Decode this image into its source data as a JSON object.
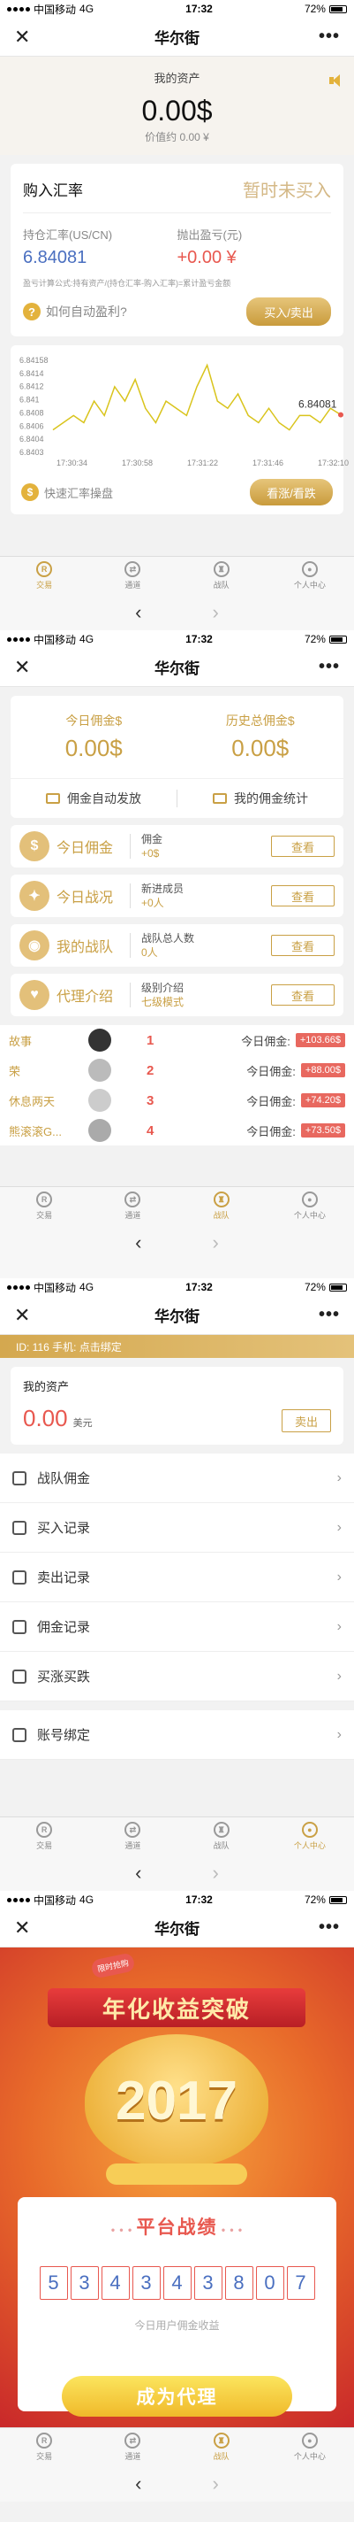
{
  "status_bar": {
    "carrier": "中国移动",
    "network": "4G",
    "time": "17:32",
    "battery": "72%"
  },
  "header": {
    "title": "华尔街",
    "close_glyph": "✕",
    "more_glyph": "•••"
  },
  "tabbar": {
    "items": [
      {
        "label": "交易",
        "glyph": "R",
        "icon": "trade-icon"
      },
      {
        "label": "通道",
        "glyph": "⇄",
        "icon": "channel-icon"
      },
      {
        "label": "战队",
        "glyph": "♜",
        "icon": "trophy-icon"
      },
      {
        "label": "个人中心",
        "glyph": "●",
        "icon": "user-icon"
      }
    ]
  },
  "navbar": {
    "back": "‹",
    "forward": "›"
  },
  "colors": {
    "gold": "#c9a045",
    "red": "#e8584f",
    "blue": "#4a6fc0"
  },
  "screen1": {
    "assets_label": "我的资产",
    "assets_value": "0.00$",
    "assets_sub": "价值约 0.00 ¥",
    "buy_title": "购入汇率",
    "buy_status": "暂时未买入",
    "hold_rate_label": "持仓汇率(US/CN)",
    "hold_rate_value": "6.84081",
    "sell_pl_label": "抛出盈亏(元)",
    "sell_pl_value": "+0.00 ¥",
    "formula": "盈亏计算公式:持有资产/(持仓汇率-购入汇率)=累计盈亏金额",
    "how_profit": "如何自动盈利?",
    "buy_sell_button": "买入/卖出",
    "chart_footer_label": "快速汇率操盘",
    "view_button": "看涨/看跌"
  },
  "chart_data": {
    "type": "line",
    "title": "",
    "xlabel": "",
    "ylabel": "",
    "y_ticks": [
      "6.84158",
      "6.8414",
      "6.8412",
      "6.841",
      "6.8408",
      "6.8406",
      "6.8404",
      "6.8403"
    ],
    "x_ticks": [
      "17:30:34",
      "17:30:58",
      "17:31:22",
      "17:31:46",
      "17:32:10"
    ],
    "ylim": [
      6.8403,
      6.84158
    ],
    "last_value_label": "6.84081",
    "series": [
      {
        "color": "#d9c41c",
        "values": [
          6.8406,
          6.8407,
          6.8408,
          6.8407,
          6.841,
          6.8408,
          6.8412,
          6.841,
          6.8413,
          6.8409,
          6.8407,
          6.841,
          6.8409,
          6.8408,
          6.8412,
          6.8415,
          6.841,
          6.8409,
          6.8411,
          6.8408,
          6.8407,
          6.8409,
          6.8407,
          6.8406,
          6.8408,
          6.8408,
          6.8407,
          6.8409,
          6.84081
        ]
      }
    ],
    "grid": false
  },
  "screen2": {
    "today_label": "今日佣金$",
    "today_value": "0.00$",
    "history_label": "历史总佣金$",
    "history_value": "0.00$",
    "auto_pay": "佣金自动发放",
    "my_stats": "我的佣金统计",
    "rows": [
      {
        "icon": "coin-icon",
        "glyph": "$",
        "name": "今日佣金",
        "a": "佣金",
        "b": "+0$",
        "btn": "查看"
      },
      {
        "icon": "runner-icon",
        "glyph": "✦",
        "name": "今日战况",
        "a": "新进成员",
        "b": "+0人",
        "btn": "查看"
      },
      {
        "icon": "team-icon",
        "glyph": "◉",
        "name": "我的战队",
        "a": "战队总人数",
        "b": "0人",
        "btn": "查看"
      },
      {
        "icon": "agent-icon",
        "glyph": "♥",
        "name": "代理介绍",
        "a": "级别介绍",
        "b": "七级模式",
        "btn": "查看"
      }
    ],
    "ranking": [
      {
        "name": "故事",
        "rank": "1",
        "label": "今日佣金:",
        "amount": "+103.66$"
      },
      {
        "name": "荣",
        "rank": "2",
        "label": "今日佣金:",
        "amount": "+88.00$"
      },
      {
        "name": "休息两天",
        "rank": "3",
        "label": "今日佣金:",
        "amount": "+74.20$"
      },
      {
        "name": "熊滚滚G...",
        "rank": "4",
        "label": "今日佣金:",
        "amount": "+73.50$"
      }
    ]
  },
  "screen3": {
    "user_id": "ID: 116 手机: 点击绑定",
    "assets_label": "我的资产",
    "assets_value": "0.00",
    "assets_unit": "美元",
    "sell_button": "卖出",
    "menu": [
      {
        "icon": "team-icon",
        "label": "战队佣金"
      },
      {
        "icon": "doc-icon",
        "label": "买入记录"
      },
      {
        "icon": "doc-icon",
        "label": "卖出记录"
      },
      {
        "icon": "doc-icon",
        "label": "佣金记录"
      },
      {
        "icon": "chart-icon",
        "label": "买涨买跌"
      }
    ],
    "menu2": [
      {
        "icon": "bind-icon",
        "label": "账号绑定"
      }
    ]
  },
  "screen4": {
    "tag": "限时抢购",
    "ribbon": "年化收益突破",
    "year": "2017",
    "stat_title": "平台战绩",
    "digits": [
      "5",
      "3",
      "4",
      "3",
      "4",
      "3",
      "8",
      "0",
      "7"
    ],
    "caption": "今日用户佣金收益",
    "agent_button": "成为代理"
  }
}
